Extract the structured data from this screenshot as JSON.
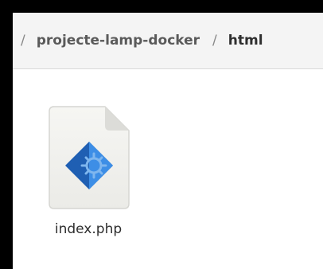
{
  "breadcrumb": {
    "separator": "/",
    "items": [
      {
        "label": "projecte-lamp-docker"
      },
      {
        "label": "html"
      }
    ]
  },
  "files": [
    {
      "name": "index.php",
      "icon": "php-source-file-icon"
    }
  ],
  "colors": {
    "pathbar_bg": "#f4f4f4",
    "icon_blue_dark": "#1f5fb3",
    "icon_blue_light": "#3d8ee6",
    "page_bg": "#f3f3f0"
  }
}
